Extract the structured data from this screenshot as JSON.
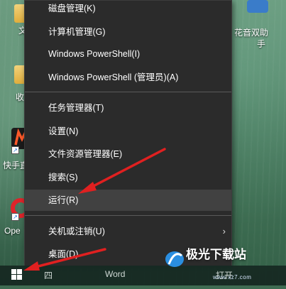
{
  "desktop": {
    "left_labels": [
      "文",
      "收",
      "快手直",
      "Ope"
    ],
    "right_label_line1": "花音双助",
    "right_label_line2": "手"
  },
  "menu": {
    "items": [
      {
        "label": "磁盘管理(K)"
      },
      {
        "label": "计算机管理(G)"
      },
      {
        "label": "Windows PowerShell(I)"
      },
      {
        "label": "Windows PowerShell (管理员)(A)"
      },
      {
        "label": "任务管理器(T)"
      },
      {
        "label": "设置(N)"
      },
      {
        "label": "文件资源管理器(E)"
      },
      {
        "label": "搜索(S)"
      },
      {
        "label": "运行(R)"
      },
      {
        "label": "关机或注销(U)"
      },
      {
        "label": "桌面(D)"
      }
    ]
  },
  "taskbar": {
    "text_left": "四",
    "text_mid": "Word",
    "text_right": "打开"
  },
  "watermark": {
    "text": "极光下载站",
    "sub": "www.xz7.com"
  },
  "colors": {
    "menu_bg": "#2b2b2b",
    "highlight": "#414141",
    "arrow": "#e02020"
  }
}
